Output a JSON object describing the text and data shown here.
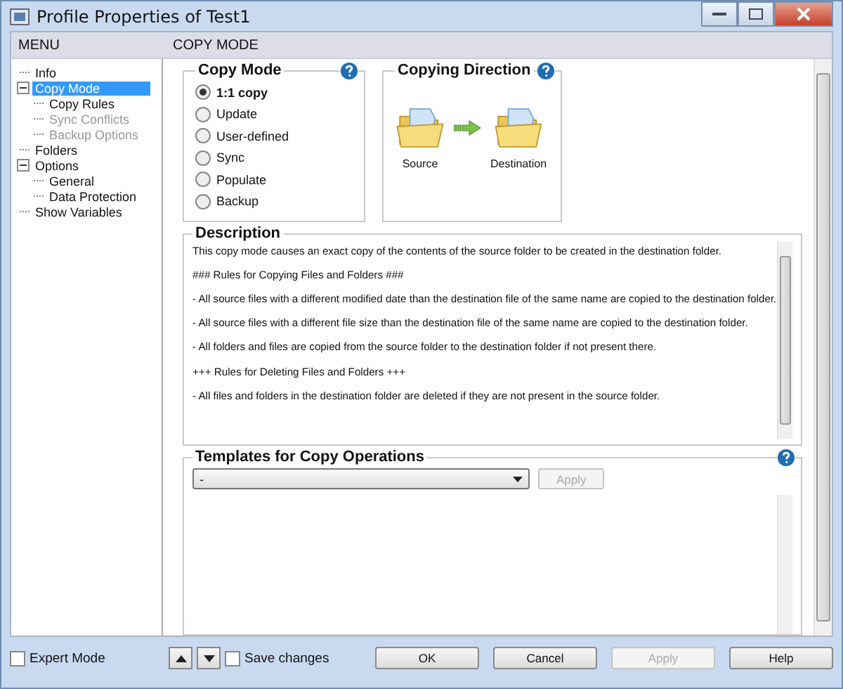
{
  "window": {
    "title": "Profile Properties of Test1"
  },
  "header": {
    "menu_label": "MENU",
    "section_title": "COPY MODE"
  },
  "tree": [
    {
      "label": "Info",
      "selected": false,
      "disabled": false
    },
    {
      "label": "Copy Mode",
      "selected": true,
      "disabled": false,
      "expanded": true,
      "children": [
        {
          "label": "Copy Rules",
          "selected": false,
          "disabled": false
        },
        {
          "label": "Sync Conflicts",
          "selected": false,
          "disabled": true
        },
        {
          "label": "Backup Options",
          "selected": false,
          "disabled": true
        }
      ]
    },
    {
      "label": "Folders",
      "selected": false,
      "disabled": false
    },
    {
      "label": "Options",
      "selected": false,
      "disabled": false,
      "expanded": true,
      "children": [
        {
          "label": "General",
          "selected": false,
          "disabled": false
        },
        {
          "label": "Data Protection",
          "selected": false,
          "disabled": false
        }
      ]
    },
    {
      "label": "Show Variables",
      "selected": false,
      "disabled": false
    }
  ],
  "copy_mode": {
    "title": "Copy Mode",
    "options": [
      {
        "label": "1:1 copy",
        "selected": true
      },
      {
        "label": "Update",
        "selected": false
      },
      {
        "label": "User-defined",
        "selected": false
      },
      {
        "label": "Sync",
        "selected": false
      },
      {
        "label": "Populate",
        "selected": false
      },
      {
        "label": "Backup",
        "selected": false
      }
    ]
  },
  "direction": {
    "title": "Copying Direction",
    "source": "Source",
    "destination": "Destination"
  },
  "description": {
    "title": "Description",
    "paragraphs": [
      "This copy mode causes an exact copy of the contents of the source folder to be created in the destination folder.",
      "### Rules for Copying Files and Folders ###",
      "- All source files with a different modified date than the destination file of the same name are copied to the destination folder.",
      "- All source files with a different file size than the destination file of the same name are copied to the destination folder.",
      "- All folders and files are copied from the source folder to the destination folder if not present there.",
      "+++ Rules for Deleting Files and Folders +++",
      "- All files and folders in the destination folder are deleted if they are not present in the source folder."
    ]
  },
  "templates": {
    "title": "Templates for Copy Operations",
    "dropdown_value": "-",
    "apply": {
      "label": "Apply",
      "disabled": true
    }
  },
  "footer": {
    "expert_mode": {
      "label": "Expert Mode",
      "checked": false
    },
    "save_changes": {
      "label": "Save changes",
      "checked": false
    },
    "buttons": [
      {
        "label": "OK",
        "disabled": false
      },
      {
        "label": "Cancel",
        "disabled": false
      },
      {
        "label": "Apply",
        "disabled": true
      },
      {
        "label": "Help",
        "disabled": false
      }
    ]
  }
}
